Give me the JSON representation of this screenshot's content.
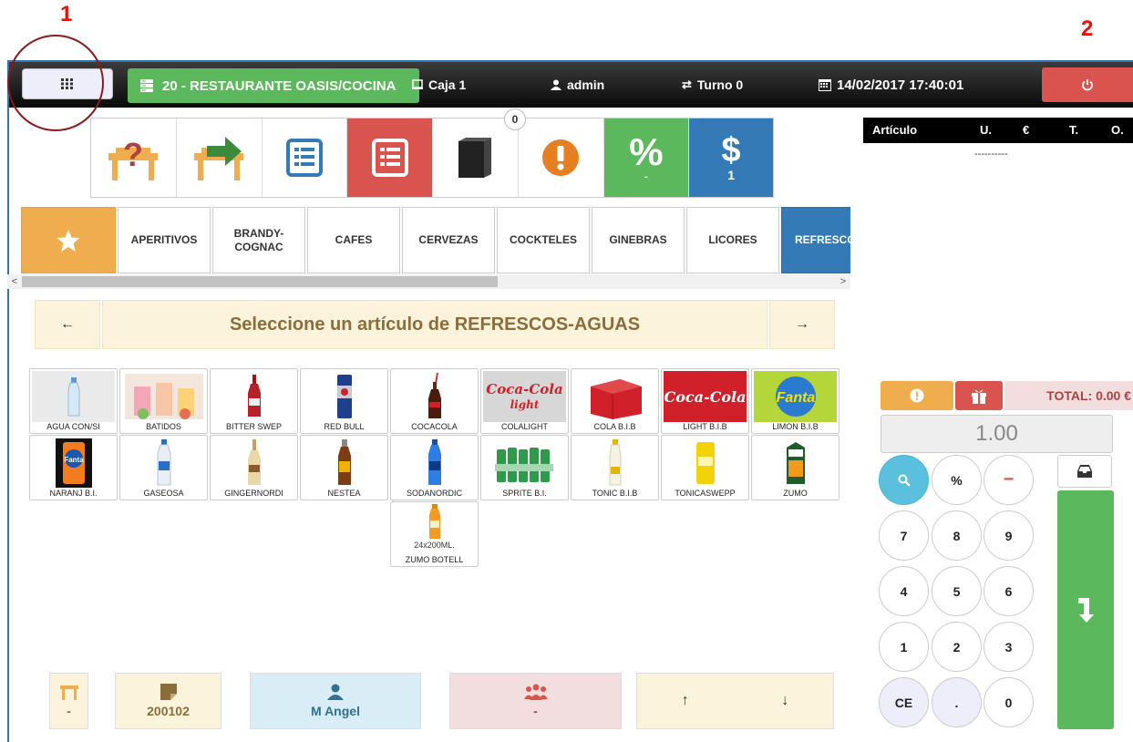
{
  "annotations": {
    "marker_1": "1",
    "marker_2": "2"
  },
  "topbar": {
    "restaurant": "20 - RESTAURANTE OASIS/COCINA",
    "register": "Caja 1",
    "user": "admin",
    "shift": "Turno 0",
    "datetime": "14/02/2017 17:40:01",
    "colors": {
      "restaurant": "#5cb85c",
      "power": "#d9534f"
    }
  },
  "actions": {
    "badge": "0",
    "discount_value": "-",
    "payment_value": "1"
  },
  "categories": [
    "APERITIVOS",
    "BRANDY-COGNAC",
    "CAFES",
    "CERVEZAS",
    "COCKTELES",
    "GINEBRAS",
    "LICORES",
    "REFRESCO"
  ],
  "selection": {
    "prompt": "Seleccione un artículo de REFRESCOS-AGUAS"
  },
  "products": [
    {
      "name": "AGUA CON/SI"
    },
    {
      "name": "BATIDOS"
    },
    {
      "name": "BITTER SWEP"
    },
    {
      "name": "RED BULL"
    },
    {
      "name": "COCACOLA"
    },
    {
      "name": "COLALIGHT",
      "img_text": "Coca-Cola light"
    },
    {
      "name": "COLA B.I.B"
    },
    {
      "name": "LIGHT B.I.B",
      "img_text": "Coca-Cola"
    },
    {
      "name": "LIMON B.I.B",
      "img_text": "Fanta"
    },
    {
      "name": "NARANJ B.I.",
      "img_text": "Fanta"
    },
    {
      "name": "GASEOSA"
    },
    {
      "name": "GINGERNORDI"
    },
    {
      "name": "NESTEA"
    },
    {
      "name": "SODANORDIC"
    },
    {
      "name": "SPRITE B.I."
    },
    {
      "name": "TONIC B.I.B"
    },
    {
      "name": "TONICASWEPP"
    },
    {
      "name": "ZUMO"
    },
    {
      "name": "ZUMO BOTELL",
      "img_text": "24x200ML."
    }
  ],
  "bottom": {
    "table_value": "-",
    "ticket": "200102",
    "waiter": "M Angel",
    "guests": "-"
  },
  "ticket_table": {
    "headers": [
      "Artículo",
      "U.",
      "€",
      "T.",
      "O."
    ],
    "empty_line": "----------"
  },
  "totals": {
    "total_label": "TOTAL: 0.00 €",
    "quantity": "1.00"
  },
  "keypad": {
    "row1": [
      "%",
      "−"
    ],
    "row2": [
      "7",
      "8",
      "9"
    ],
    "row3": [
      "4",
      "5",
      "6"
    ],
    "row4": [
      "1",
      "2",
      "3"
    ],
    "row5": [
      "CE",
      ".",
      "0"
    ]
  }
}
